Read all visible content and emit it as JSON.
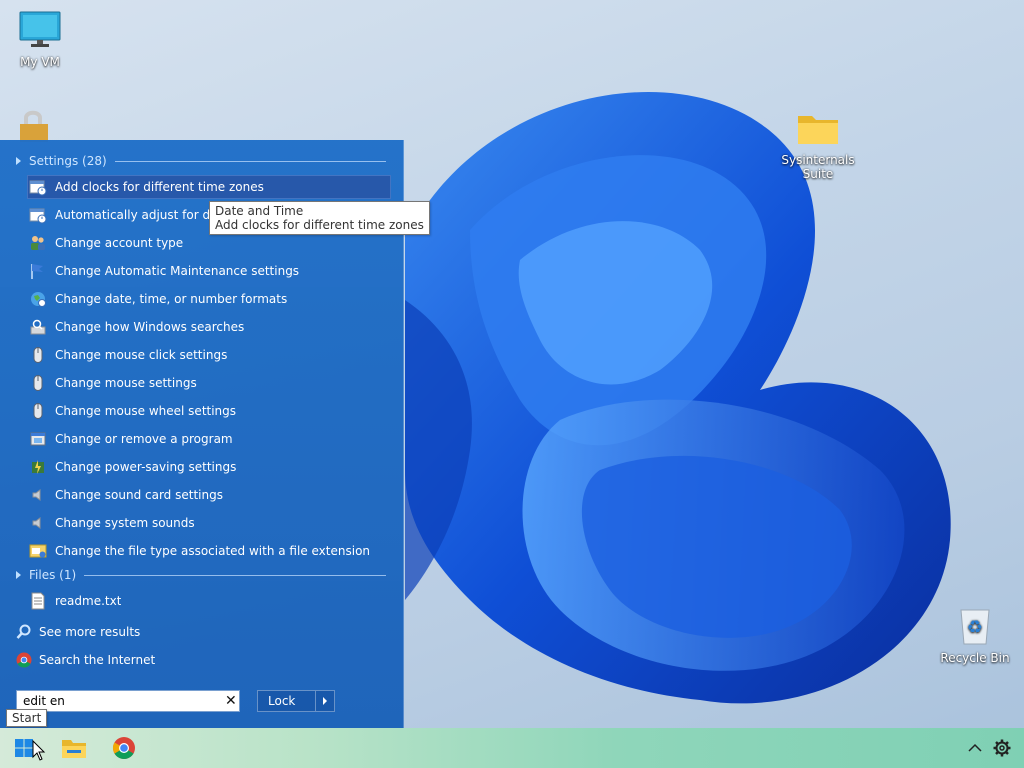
{
  "desktop": {
    "icons": [
      {
        "label": "My VM",
        "icon": "monitor-icon"
      },
      {
        "label": "",
        "icon": "lock-shield-icon"
      },
      {
        "label": "Sysinternals\nSuite",
        "icon": "folder-icon"
      },
      {
        "label": "Recycle Bin",
        "icon": "recycle-bin-icon"
      }
    ]
  },
  "startmenu": {
    "settings_group": "Settings (28)",
    "settings_items": [
      {
        "label": "Add clocks for different time zones",
        "icon": "datetime-icon"
      },
      {
        "label": "Automatically adjust for dayli",
        "icon": "datetime-icon"
      },
      {
        "label": "Change account type",
        "icon": "users-icon"
      },
      {
        "label": "Change Automatic Maintenance settings",
        "icon": "flag-icon"
      },
      {
        "label": "Change date, time, or number formats",
        "icon": "region-icon"
      },
      {
        "label": "Change how Windows searches",
        "icon": "indexing-icon"
      },
      {
        "label": "Change mouse click settings",
        "icon": "mouse-icon"
      },
      {
        "label": "Change mouse settings",
        "icon": "mouse-icon"
      },
      {
        "label": "Change mouse wheel settings",
        "icon": "mouse-icon"
      },
      {
        "label": "Change or remove a program",
        "icon": "programs-icon"
      },
      {
        "label": "Change power-saving settings",
        "icon": "power-icon"
      },
      {
        "label": "Change sound card settings",
        "icon": "speaker-icon"
      },
      {
        "label": "Change system sounds",
        "icon": "speaker-icon"
      },
      {
        "label": "Change the file type associated with a file extension",
        "icon": "default-programs-icon"
      }
    ],
    "files_group": "Files (1)",
    "file_items": [
      {
        "label": "readme.txt",
        "icon": "text-file-icon"
      }
    ],
    "see_more": "See more results",
    "search_internet": "Search the Internet",
    "search": {
      "value": "edit en"
    },
    "lock_label": "Lock"
  },
  "tooltips": {
    "item_title": "Date and Time",
    "item_desc": "Add clocks for different time zones",
    "start": "Start"
  },
  "colors": {
    "menu_bg": "#1f6ec8",
    "selected": "#2a5aa8",
    "accent_light": "#cfe6ff"
  }
}
